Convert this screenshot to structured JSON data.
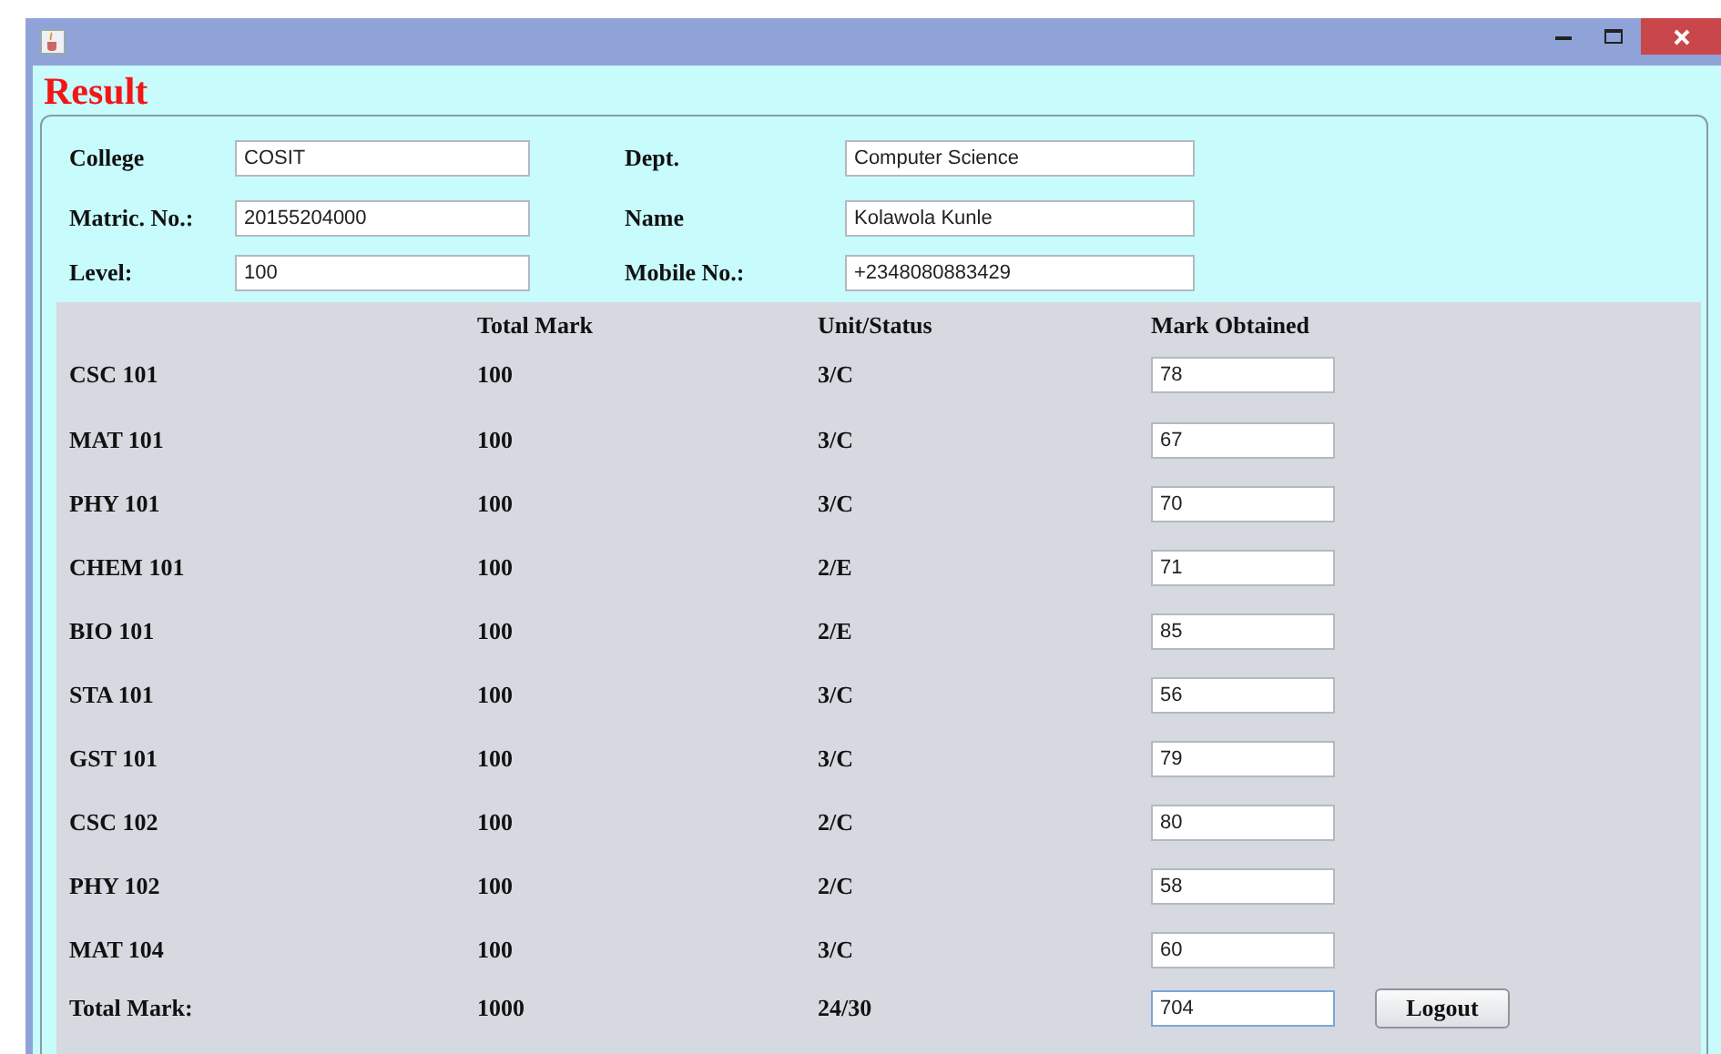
{
  "window": {
    "controls": [
      {
        "kind": "minimize"
      },
      {
        "kind": "maximize"
      },
      {
        "kind": "close"
      }
    ]
  },
  "heading": "Result",
  "profile": [
    {
      "label": "College",
      "value": "COSIT"
    },
    {
      "label": "Dept.",
      "value": "Computer Science"
    },
    {
      "label": "Matric. No.:",
      "value": "20155204000"
    },
    {
      "label": "Name",
      "value": "Kolawola Kunle"
    },
    {
      "label": "Level:",
      "value": "100"
    },
    {
      "label": "Mobile No.:",
      "value": "+2348080883429"
    }
  ],
  "table": {
    "columns": [
      "Total Mark",
      "Unit/Status",
      "Mark Obtained"
    ],
    "rows": [
      {
        "course": "CSC 101",
        "total": "100",
        "unit": "3/C",
        "mark": "78"
      },
      {
        "course": "MAT 101",
        "total": "100",
        "unit": "3/C",
        "mark": "67"
      },
      {
        "course": "PHY 101",
        "total": "100",
        "unit": "3/C",
        "mark": "70"
      },
      {
        "course": "CHEM 101",
        "total": "100",
        "unit": "2/E",
        "mark": "71"
      },
      {
        "course": "BIO 101",
        "total": "100",
        "unit": "2/E",
        "mark": "85"
      },
      {
        "course": "STA 101",
        "total": "100",
        "unit": "3/C",
        "mark": "56"
      },
      {
        "course": "GST 101",
        "total": "100",
        "unit": "3/C",
        "mark": "79"
      },
      {
        "course": "CSC 102",
        "total": "100",
        "unit": "2/C",
        "mark": "80"
      },
      {
        "course": "PHY 102",
        "total": "100",
        "unit": "2/C",
        "mark": "58"
      },
      {
        "course": "MAT 104",
        "total": "100",
        "unit": "3/C",
        "mark": "60"
      }
    ],
    "total_row": {
      "label": "Total Mark:",
      "total": "1000",
      "unit": "24/30",
      "mark": "704",
      "focused": true
    }
  },
  "logout_button": "Logout"
}
